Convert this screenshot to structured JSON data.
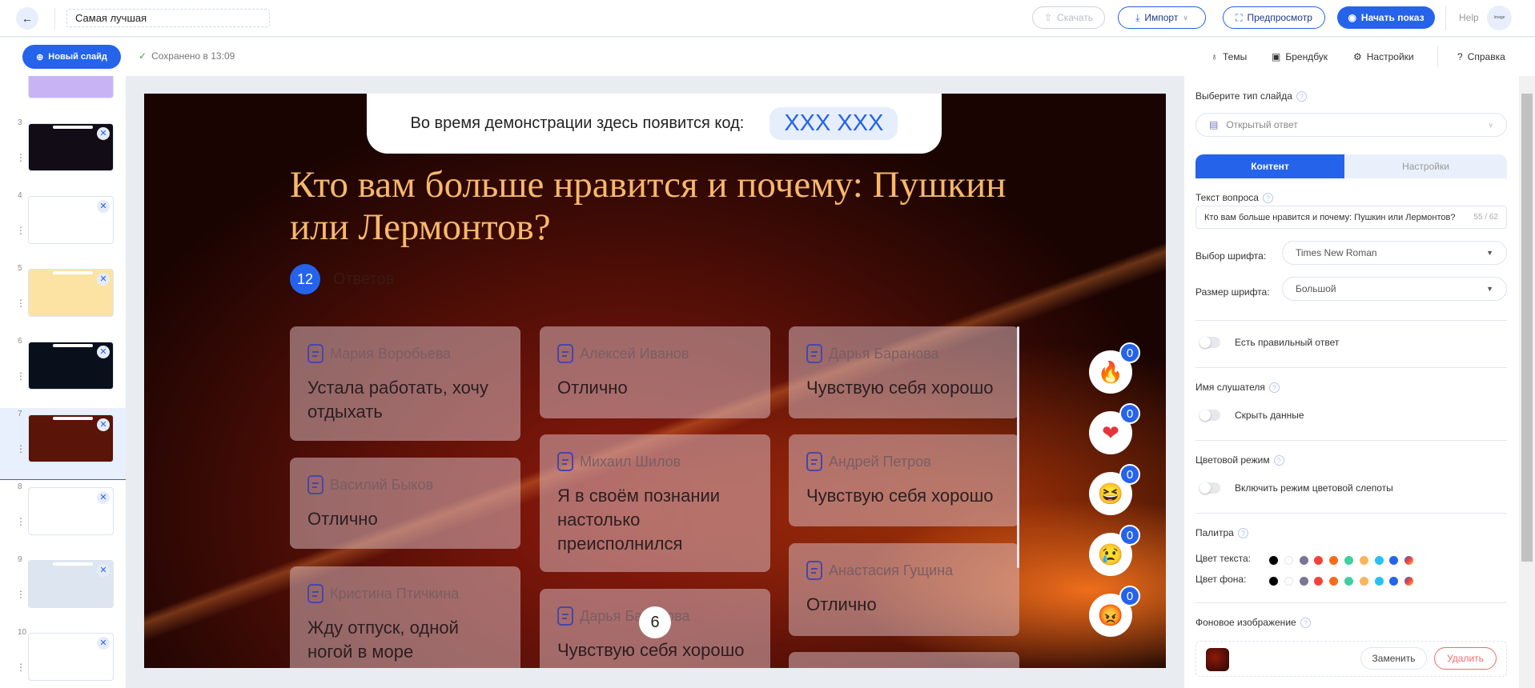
{
  "topbar": {
    "back_icon": "arrow-left-icon",
    "title": "Самая лучшая",
    "download": "Скачать",
    "import": "Импорт",
    "preview": "Предпросмотр",
    "start": "Начать показ",
    "help": "Help",
    "avatar": "Image"
  },
  "toolbar": {
    "new_slide": "Новый слайд",
    "saved": "Сохранено в 13:09",
    "themes": "Темы",
    "brandbook": "Брендбук",
    "settings": "Настройки",
    "reference": "Справка"
  },
  "sidebar": {
    "slides": [
      {
        "num": "",
        "bg": "#c8b4f5"
      },
      {
        "num": "3",
        "bg": "#120c16"
      },
      {
        "num": "4",
        "bg": "#ffffff"
      },
      {
        "num": "5",
        "bg": "#fde3a3"
      },
      {
        "num": "6",
        "bg": "#0a0f1c"
      },
      {
        "num": "7",
        "bg": "#5a1408",
        "active": true
      },
      {
        "num": "8",
        "bg": "#ffffff"
      },
      {
        "num": "9",
        "bg": "#dde6f0"
      },
      {
        "num": "10",
        "bg": "#ffffff"
      }
    ]
  },
  "slide": {
    "code_label": "Во время демонстрации здесь появится код:",
    "code": "XXX XXX",
    "title": "Кто вам больше нравится и почему: Пушкин или Лермонтов?",
    "count": "12",
    "count_label": "Ответов",
    "page_badge": "6",
    "cards": [
      {
        "name": "Мария Воробьева",
        "text": "Устала работать, хочу отдыхать"
      },
      {
        "name": "Василий Быков",
        "text": "Отлично"
      },
      {
        "name": "Кристина Птичкина",
        "text": "Жду отпуск, одной ногой в море"
      },
      {
        "name": "Алексей Иванов",
        "text": "Отлично"
      },
      {
        "name": "Михаил Шилов",
        "text": "Я в своём познании настолько преисполнился"
      },
      {
        "name": "Дарья Баранова",
        "text": "Чувствую себя хорошо"
      },
      {
        "name": "Дарья Баранова",
        "text": "Чувствую себя хорошо"
      },
      {
        "name": "Андрей Петров",
        "text": "Чувствую себя хорошо"
      },
      {
        "name": "Анастасия Гущина",
        "text": "Отлично"
      }
    ],
    "reactions": [
      {
        "icon": "fire-icon",
        "glyph": "🔥",
        "count": "0"
      },
      {
        "icon": "heart-icon",
        "glyph": "❤",
        "count": "0"
      },
      {
        "icon": "laughing-face-icon",
        "glyph": "😆",
        "count": "0"
      },
      {
        "icon": "crying-face-icon",
        "glyph": "😢",
        "count": "0"
      },
      {
        "icon": "angry-face-icon",
        "glyph": "😡",
        "count": "0"
      }
    ]
  },
  "panel": {
    "slide_type_label": "Выберите тип слайда",
    "slide_type": "Открытый ответ",
    "tab_content": "Контент",
    "tab_settings": "Настройки",
    "question_label": "Текст вопроса",
    "question_value": "Кто вам больше нравится и почему: Пушкин или Лермонтов?",
    "question_counter": "55 / 62",
    "font_label": "Выбор шрифта:",
    "font_value": "Times New Roman",
    "size_label": "Размер шрифта:",
    "size_value": "Большой",
    "correct_toggle": "Есть правильный ответ",
    "listener_label": "Имя слушателя",
    "hide_toggle": "Скрыть данные",
    "color_mode_label": "Цветовой режим",
    "colorblind_toggle": "Включить режим цветовой слепоты",
    "palette_label": "Палитра",
    "text_color_label": "Цвет текста:",
    "bg_color_label": "Цвет фона:",
    "palette": [
      "#000000",
      "#ffffff",
      "#7b7597",
      "#f44336",
      "#f96b1a",
      "#3fcfa0",
      "#f9b55a",
      "#29c1f5",
      "#2563eb",
      "multicolor"
    ],
    "bg_image_label": "Фоновое изображение",
    "replace": "Заменить",
    "delete": "Удалить"
  },
  "colors": {
    "accent": "#2563eb",
    "title": "#f7b86a",
    "delete": "#f26b6b"
  }
}
